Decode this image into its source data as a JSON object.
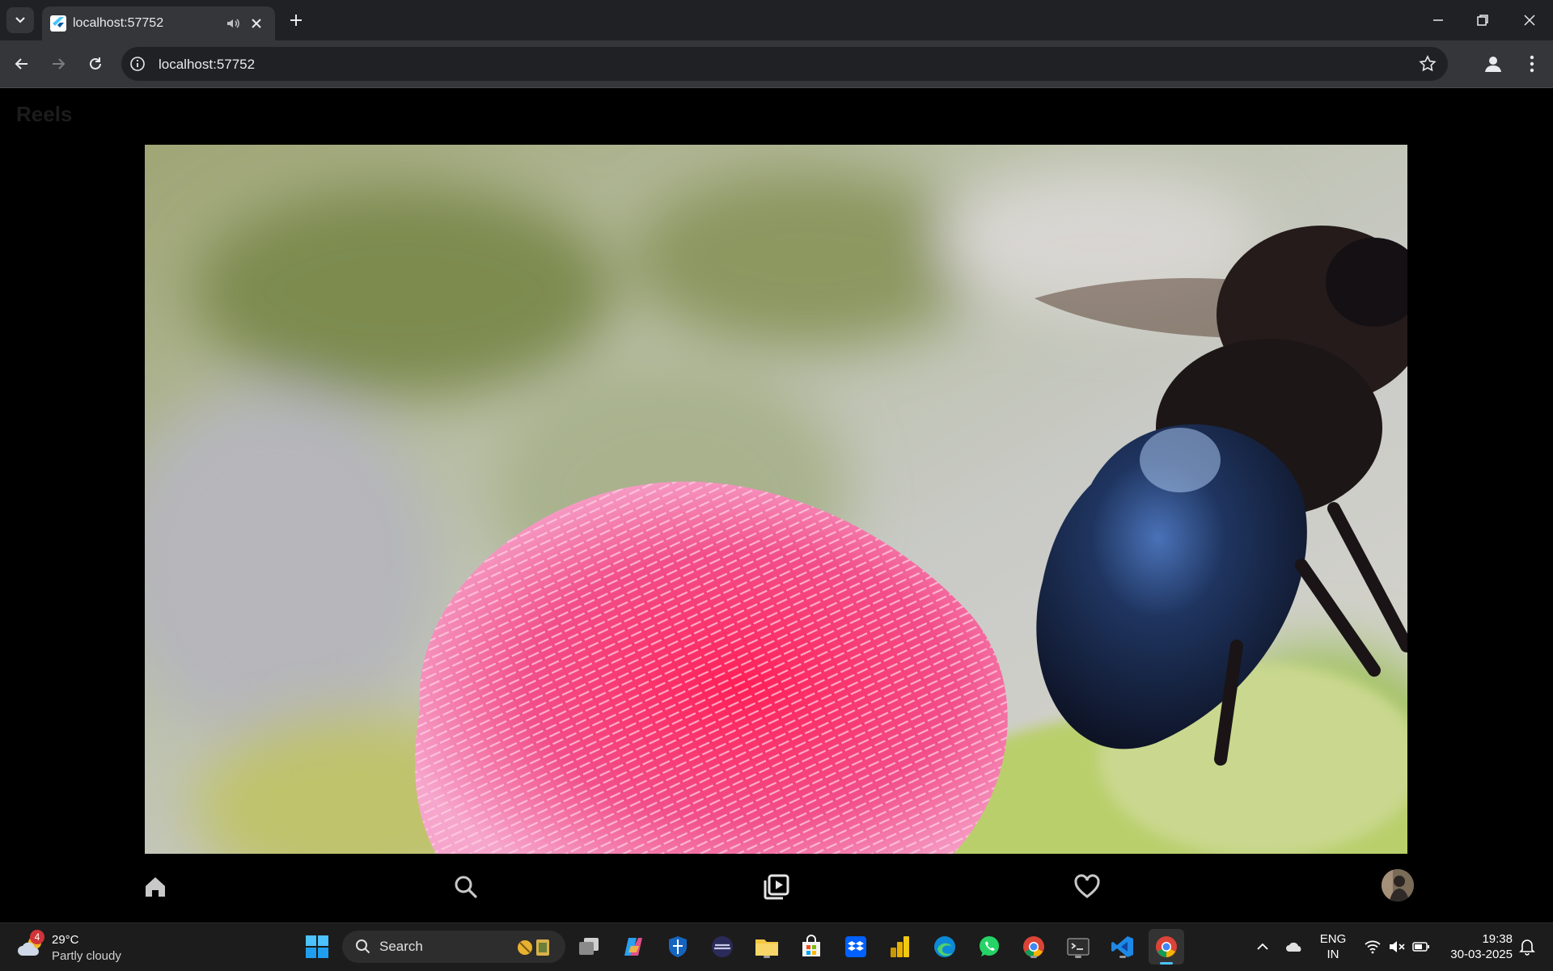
{
  "browser": {
    "tab": {
      "title": "localhost:57752"
    },
    "address": {
      "url": "localhost:57752"
    }
  },
  "page": {
    "title": "Reels",
    "video": {
      "description": "macro video of a black carpenter bee on a pink thistle flower"
    },
    "bottom_nav": [
      {
        "name": "home",
        "icon": "home-icon"
      },
      {
        "name": "search",
        "icon": "search-icon"
      },
      {
        "name": "reels",
        "icon": "reels-icon"
      },
      {
        "name": "favorites",
        "icon": "heart-icon"
      },
      {
        "name": "profile",
        "icon": "avatar"
      }
    ]
  },
  "taskbar": {
    "weather": {
      "temp": "29°C",
      "desc": "Partly cloudy",
      "badge": "4"
    },
    "search_label": "Search",
    "apps": [
      "task-view",
      "copilot",
      "defender",
      "pen-app",
      "file-explorer",
      "microsoft-store",
      "dropbox",
      "power-bi",
      "edge",
      "whatsapp",
      "chrome",
      "terminal",
      "vscode",
      "chrome-active"
    ],
    "tray": {
      "lang_line1": "ENG",
      "lang_line2": "IN",
      "time": "19:38",
      "date": "30-03-2025"
    }
  }
}
